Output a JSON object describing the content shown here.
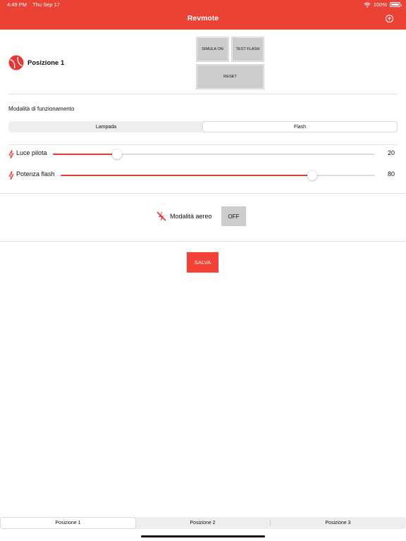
{
  "status_bar": {
    "time": "4:49 PM",
    "date": "Thu Sep 17",
    "battery": "100%"
  },
  "nav": {
    "title": "Revmote"
  },
  "position": {
    "title": "Posizione 1"
  },
  "buttons": {
    "simula_on": "SIMULA ON",
    "test_flash": "TEST FLASH",
    "reset": "RESET"
  },
  "mode": {
    "label": "Modalità di funzionamento",
    "options": [
      "Lampada",
      "Flash"
    ],
    "selected": "Flash"
  },
  "sliders": [
    {
      "label": "Luce pilota",
      "value": 20,
      "fraction": 0.2
    },
    {
      "label": "Potenza flash",
      "value": 80,
      "fraction": 0.8
    }
  ],
  "airplane": {
    "label": "Modalità aereo",
    "toggle": "OFF"
  },
  "save": {
    "label": "SALVA"
  },
  "tabs": {
    "items": [
      "Posizione 1",
      "Posizione 2",
      "Posizione 3"
    ],
    "selected": "Posizione 1"
  },
  "colors": {
    "accent": "#ea4335",
    "save": "#f44336",
    "slider_fill": "#e53935",
    "button_gray": "#cccccc"
  },
  "icons": {
    "position": "tennis-ball-icon",
    "slider": "lightning-icon",
    "airplane": "no-flash-icon",
    "add": "plus-circle-icon",
    "wifi": "wifi-icon",
    "battery": "battery-icon"
  }
}
